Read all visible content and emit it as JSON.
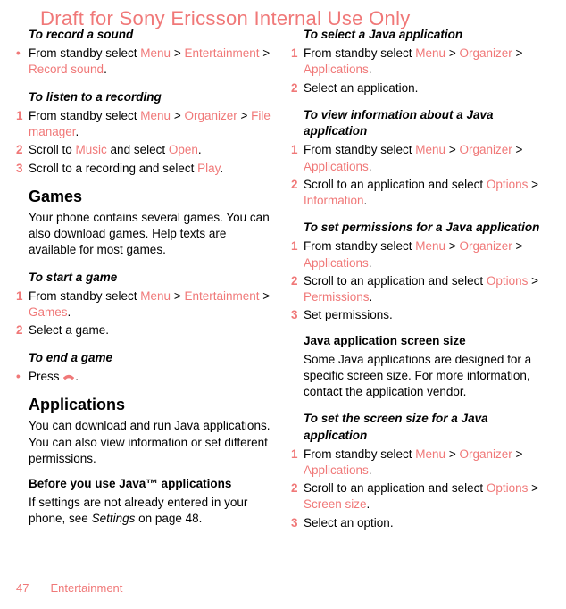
{
  "watermark": "Draft for Sony Ericsson Internal Use Only",
  "left": {
    "record_title": "To record a sound",
    "record_step": {
      "pre": "From standby select ",
      "m": "Menu",
      "gt1": " > ",
      "ent": "Entertainment",
      "gt2": " > ",
      "rs": "Record sound",
      "dot": "."
    },
    "listen_title": "To listen to a recording",
    "listen_s1": {
      "pre": "From standby select ",
      "m": "Menu",
      "gt1": " > ",
      "org": "Organizer",
      "gt2": " > ",
      "fm": "File manager",
      "dot": "."
    },
    "listen_s2": {
      "pre": "Scroll to ",
      "mus": "Music",
      "mid": " and select ",
      "open": "Open",
      "dot": "."
    },
    "listen_s3": {
      "pre": "Scroll to a recording and select ",
      "play": "Play",
      "dot": "."
    },
    "games_h": "Games",
    "games_body": "Your phone contains several games. You can also download games. Help texts are available for most games.",
    "start_title": "To start a game",
    "start_s1": {
      "pre": "From standby select ",
      "m": "Menu",
      "gt1": " > ",
      "ent": "Entertainment",
      "gt2": " > ",
      "g": "Games",
      "dot": "."
    },
    "start_s2": "Select a game.",
    "end_title": "To end a game",
    "end_step": {
      "pre": "Press ",
      "dot": "."
    },
    "apps_h": "Applications",
    "apps_body": "You can download and run Java applications. You can also view information or set different permissions.",
    "before_h": "Before you use Java™ applications",
    "before_body": {
      "pre": "If settings are not already entered in your phone, see ",
      "i": "Settings",
      "post": " on page 48."
    }
  },
  "right": {
    "select_title": "To select a Java application",
    "select_s1": {
      "pre": "From standby select ",
      "m": "Menu",
      "gt1": " > ",
      "org": "Organizer",
      "gt2": " > ",
      "app": "Applications",
      "dot": "."
    },
    "select_s2": "Select an application.",
    "view_title": "To view information about a Java application",
    "view_s1": {
      "pre": "From standby select ",
      "m": "Menu",
      "gt1": " > ",
      "org": "Organizer",
      "gt2": " > ",
      "app": "Applications",
      "dot": "."
    },
    "view_s2": {
      "pre": "Scroll to an application and select ",
      "opt": "Options",
      "gt": " > ",
      "info": "Information",
      "dot": "."
    },
    "perm_title": "To set permissions for a Java application",
    "perm_s1": {
      "pre": "From standby select ",
      "m": "Menu",
      "gt1": " > ",
      "org": "Organizer",
      "gt2": " > ",
      "app": "Applications",
      "dot": "."
    },
    "perm_s2": {
      "pre": "Scroll to an application and select ",
      "opt": "Options",
      "gt": " > ",
      "perm": "Permissions",
      "dot": "."
    },
    "perm_s3": "Set permissions.",
    "size_h": "Java application screen size",
    "size_body": "Some Java applications are designed for a specific screen size. For more information, contact the application vendor.",
    "size_title": "To set the screen size for a Java application",
    "size_s1": {
      "pre": "From standby select ",
      "m": "Menu",
      "gt1": " > ",
      "org": "Organizer",
      "gt2": " > ",
      "app": "Applications",
      "dot": "."
    },
    "size_s2": {
      "pre": "Scroll to an application and select ",
      "opt": "Options",
      "gt": " > ",
      "ss": "Screen size",
      "dot": "."
    },
    "size_s3": "Select an option."
  },
  "footer": {
    "page": "47",
    "section": "Entertainment"
  },
  "nums": {
    "n1": "1",
    "n2": "2",
    "n3": "3",
    "bullet": "•"
  }
}
